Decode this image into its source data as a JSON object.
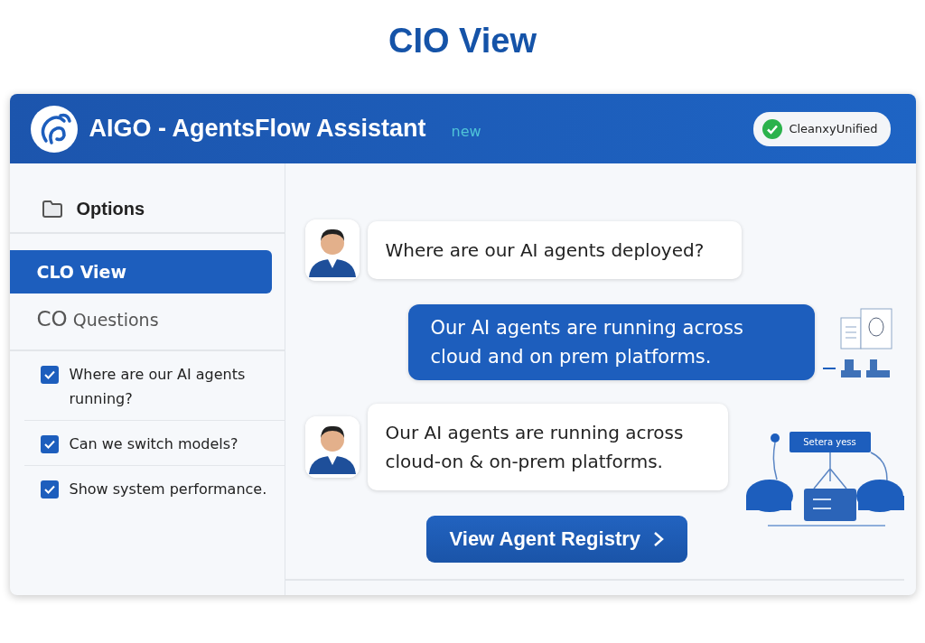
{
  "page_title": "CIO View",
  "window": {
    "title": "AIGO - AgentsFlow Assistant",
    "badge": "new",
    "status": {
      "label": "CleanxyUnified",
      "ok": true
    }
  },
  "sidebar": {
    "heading": "Options",
    "nav": [
      {
        "label": "CLO View",
        "selected": true
      },
      {
        "prefix": "CO",
        "label": "Questions",
        "selected": false
      }
    ],
    "checklist": [
      {
        "label": "Where are our AI agents running?",
        "checked": true
      },
      {
        "label": "Can we switch models?",
        "checked": true
      },
      {
        "label": "Show system performance.",
        "checked": true
      }
    ]
  },
  "chat": {
    "messages": [
      {
        "kind": "user",
        "text": "Where are our AI agents deployed?"
      },
      {
        "kind": "assistant",
        "text": "Our AI agents are running across cloud and on prem platforms."
      },
      {
        "kind": "user",
        "text": "Our AI agents are running across cloud-on & on-prem platforms."
      }
    ],
    "diagram_label": "Setera yess",
    "action": "View Agent Registry"
  }
}
